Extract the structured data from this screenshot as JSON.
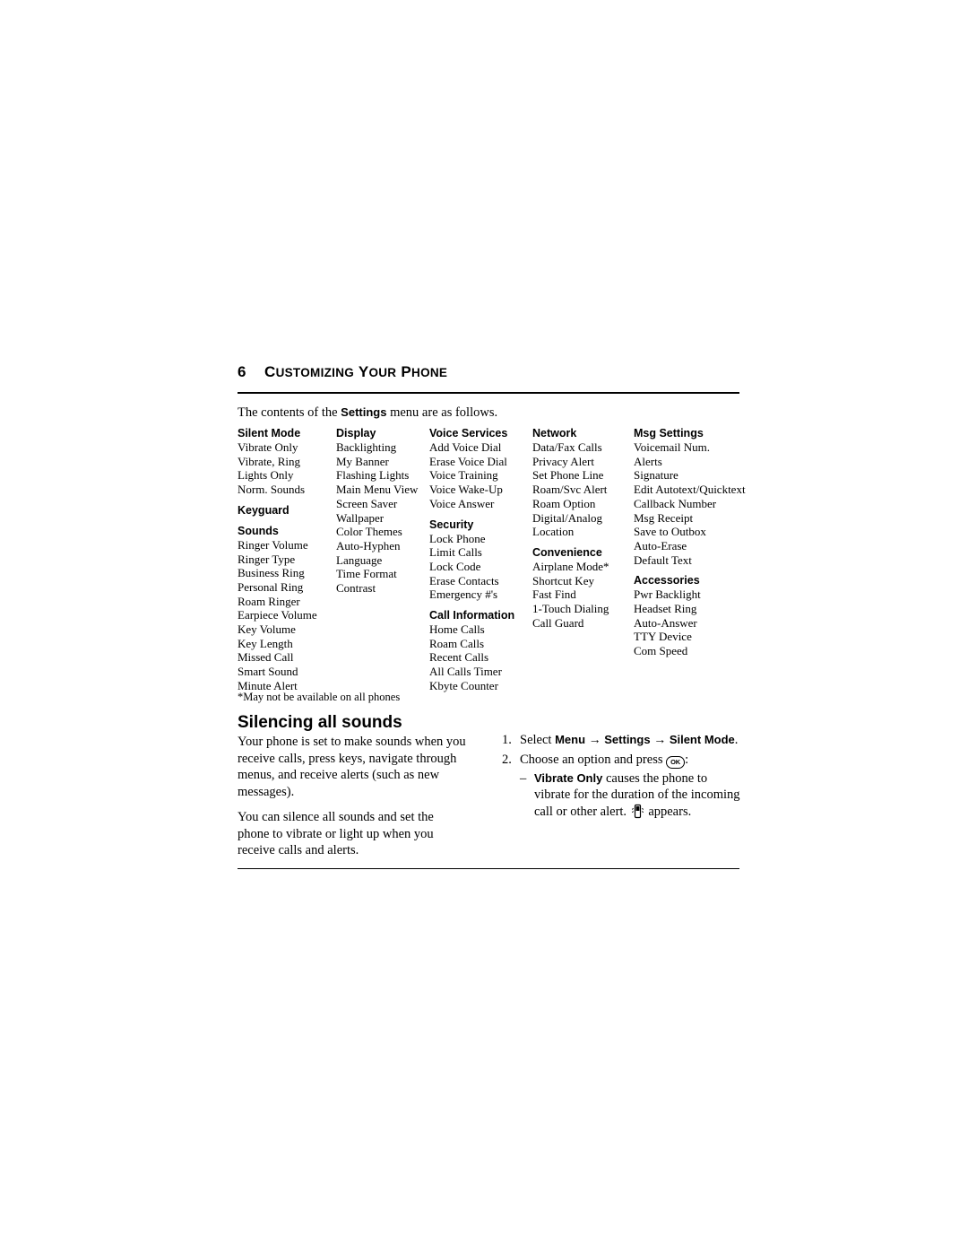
{
  "chapter": {
    "number": "6",
    "title_first": "C",
    "title_rest": "USTOMIZING",
    "title_word2_first": "Y",
    "title_word2_rest": "OUR",
    "title_word3_first": "P",
    "title_word3_rest": "HONE"
  },
  "intro": {
    "before": "The contents of the ",
    "bold": "Settings",
    "after": " menu are as follows."
  },
  "menu_columns": [
    {
      "groups": [
        {
          "heading": "Silent Mode",
          "items": [
            "Vibrate Only",
            "Vibrate, Ring",
            "Lights Only",
            "Norm. Sounds"
          ]
        },
        {
          "heading": "Keyguard",
          "items": []
        },
        {
          "heading": "Sounds",
          "items": [
            "Ringer Volume",
            "Ringer Type",
            "Business Ring",
            "Personal Ring",
            "Roam Ringer",
            "Earpiece Volume",
            "Key Volume",
            "Key Length",
            "Missed Call",
            "Smart Sound",
            "Minute Alert"
          ]
        }
      ]
    },
    {
      "groups": [
        {
          "heading": "Display",
          "items": [
            "Backlighting",
            "My Banner",
            "Flashing Lights",
            "Main Menu View",
            "Screen Saver",
            "Wallpaper",
            "Color Themes",
            "Auto-Hyphen",
            "Language",
            "Time Format",
            "Contrast"
          ]
        }
      ]
    },
    {
      "groups": [
        {
          "heading": "Voice Services",
          "items": [
            "Add Voice Dial",
            "Erase Voice Dial",
            "Voice Training",
            "Voice Wake-Up",
            "Voice Answer"
          ]
        },
        {
          "heading": "Security",
          "items": [
            "Lock Phone",
            "Limit Calls",
            "Lock Code",
            "Erase Contacts",
            "Emergency #'s"
          ]
        },
        {
          "heading": "Call Information",
          "items": [
            "Home Calls",
            "Roam Calls",
            "Recent Calls",
            "All Calls Timer",
            "Kbyte Counter"
          ]
        }
      ]
    },
    {
      "groups": [
        {
          "heading": "Network",
          "items": [
            "Data/Fax Calls",
            "Privacy Alert",
            "Set Phone Line",
            "Roam/Svc Alert",
            "Roam Option",
            "Digital/Analog",
            "Location"
          ]
        },
        {
          "heading": "Convenience",
          "items": [
            "Airplane Mode*",
            "Shortcut Key",
            "Fast Find",
            "1-Touch Dialing",
            "Call Guard"
          ]
        }
      ]
    },
    {
      "groups": [
        {
          "heading": "Msg Settings",
          "items": [
            "Voicemail Num.",
            "Alerts",
            "Signature",
            "Edit Autotext/Quicktext",
            "Callback Number",
            "Msg Receipt",
            "Save to Outbox",
            "Auto-Erase",
            "Default Text"
          ]
        },
        {
          "heading": "Accessories",
          "items": [
            "Pwr Backlight",
            "Headset Ring",
            "Auto-Answer",
            "TTY Device",
            "Com Speed"
          ]
        }
      ]
    }
  ],
  "footnote": "*May not be available on all phones",
  "section": {
    "title": "Silencing all sounds"
  },
  "body_left": {
    "para1": "Your phone is set to make sounds when you receive calls, press keys, navigate through menus, and receive alerts (such as new messages).",
    "para2": "You can silence all sounds and set the phone to vibrate or light up when you receive calls and alerts."
  },
  "steps": {
    "step1_num": "1.",
    "step1_a": "Select ",
    "step1_menu": "Menu",
    "step1_arrow1": "→",
    "step1_settings": "Settings",
    "step1_arrow2": "→",
    "step1_silent": "Silent Mode",
    "step1_end": ".",
    "step2_num": "2.",
    "step2_a": "Choose an option and press ",
    "step2_key": "OK",
    "step2_end": ":",
    "sub_dash": "–",
    "sub_bold": "Vibrate Only",
    "sub_text": " causes the phone to vibrate for the duration of the incoming call or other alert. ",
    "sub_text_end": " appears."
  }
}
